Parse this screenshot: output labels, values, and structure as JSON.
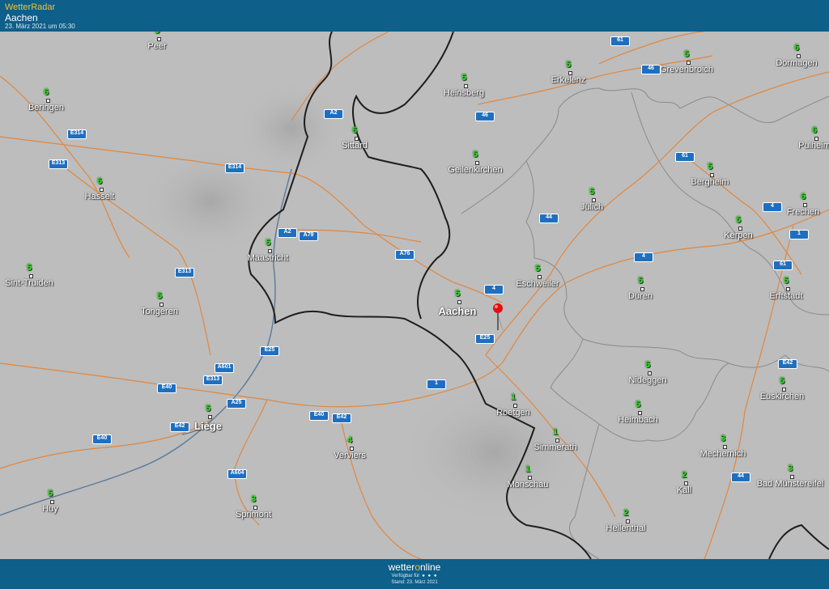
{
  "header": {
    "brand": "WetterRadar",
    "place": "Aachen",
    "datetime": "23. März 2021 um 05:30"
  },
  "footer": {
    "logo_pre": "wetter",
    "logo_o": "o",
    "logo_post": "nline",
    "available": "Verfügbar für",
    "stand": "Stand: 23. März 2021"
  },
  "colors": {
    "header_bg": "#0e5f8a",
    "map_bg": "#bdbdbd",
    "road": "#e0873f",
    "border": "#1e1e1e",
    "district": "#8a8a8a",
    "river": "#5a7a9a",
    "road_sign": "#1f6fc0",
    "value": "#39d42a",
    "pin": "#e01010"
  },
  "icons": {
    "pin": "location-pin-icon"
  },
  "cities": [
    {
      "name": "Peer",
      "value": "5"
    },
    {
      "name": "Beringen",
      "value": "6"
    },
    {
      "name": "Hasselt",
      "value": "6"
    },
    {
      "name": "Sint-Truiden",
      "value": "5"
    },
    {
      "name": "Tongeren",
      "value": "5"
    },
    {
      "name": "Maastricht",
      "value": "5"
    },
    {
      "name": "Sittard",
      "value": "6"
    },
    {
      "name": "Heinsberg",
      "value": "5"
    },
    {
      "name": "Erkelenz",
      "value": "5"
    },
    {
      "name": "Grevenbroich",
      "value": "5"
    },
    {
      "name": "Dormagen",
      "value": "6"
    },
    {
      "name": "Geilenkirchen",
      "value": "5"
    },
    {
      "name": "Jülich",
      "value": "5"
    },
    {
      "name": "Bergheim",
      "value": "5"
    },
    {
      "name": "Pulheim",
      "value": "6"
    },
    {
      "name": "Frechen",
      "value": "6"
    },
    {
      "name": "Kerpen",
      "value": "5"
    },
    {
      "name": "Aachen",
      "value": "5"
    },
    {
      "name": "Eschweiler",
      "value": "5"
    },
    {
      "name": "Düren",
      "value": "5"
    },
    {
      "name": "Erftstadt",
      "value": "5"
    },
    {
      "name": "Liège",
      "value": "5"
    },
    {
      "name": "Verviers",
      "value": "4"
    },
    {
      "name": "Roetgen",
      "value": "1"
    },
    {
      "name": "Simmerath",
      "value": "1"
    },
    {
      "name": "Nideggen",
      "value": "5"
    },
    {
      "name": "Heimbach",
      "value": "5"
    },
    {
      "name": "Euskirchen",
      "value": "5"
    },
    {
      "name": "Monschau",
      "value": "1"
    },
    {
      "name": "Mechernich",
      "value": "3"
    },
    {
      "name": "Kall",
      "value": "2"
    },
    {
      "name": "Bad Münstereifel",
      "value": "3"
    },
    {
      "name": "Huy",
      "value": "5"
    },
    {
      "name": "Sprimont",
      "value": "3"
    },
    {
      "name": "Hellenthal",
      "value": "2"
    }
  ],
  "roads": [
    "61",
    "46",
    "A2",
    "46",
    "E314",
    "E313",
    "E314",
    "61",
    "A2",
    "A79",
    "A76",
    "4",
    "44",
    "4",
    "1",
    "4",
    "61",
    "E313",
    "E25",
    "A601",
    "E313",
    "E40",
    "A25",
    "E40",
    "E42",
    "E40",
    "A604",
    "E42",
    "E25",
    "E42",
    "44",
    "1",
    "1",
    "E40"
  ]
}
